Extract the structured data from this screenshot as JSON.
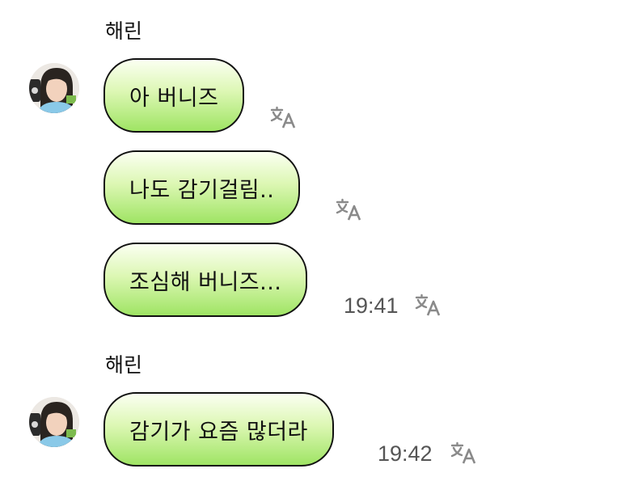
{
  "colors": {
    "bubble_top": "#fbfff2",
    "bubble_bottom": "#9fe464",
    "bubble_border": "#111111",
    "timestamp": "#555555",
    "translate_icon": "#8a8a8a"
  },
  "icons": {
    "translate": "translate-icon",
    "avatar": "profile-photo"
  },
  "groups": [
    {
      "sender": "해린",
      "messages": [
        {
          "text": "아 버니즈",
          "time": ""
        },
        {
          "text": "나도 감기걸림..",
          "time": ""
        },
        {
          "text": "조심해 버니즈...",
          "time": "19:41"
        }
      ]
    },
    {
      "sender": "해린",
      "messages": [
        {
          "text": "감기가 요즘 많더라",
          "time": "19:42"
        }
      ]
    }
  ]
}
